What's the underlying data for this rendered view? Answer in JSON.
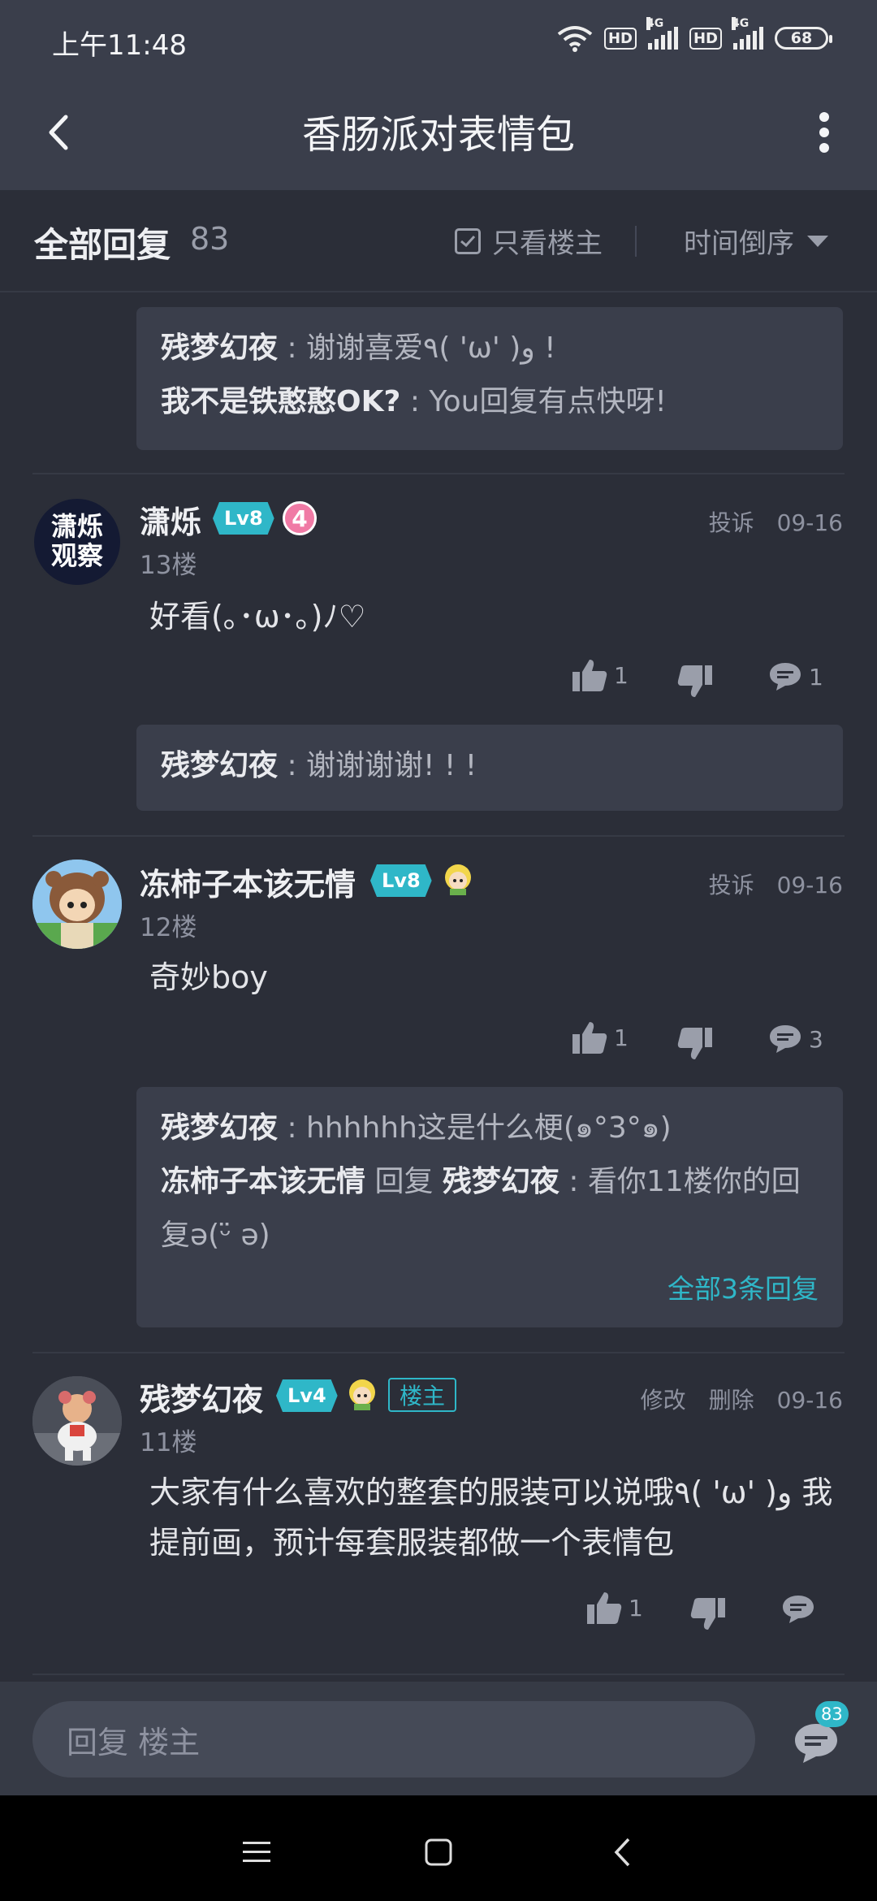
{
  "status": {
    "time": "上午11:48",
    "hd1": "HD",
    "net1": "4G",
    "hd2": "HD",
    "net2": "4G",
    "battery": "68"
  },
  "header": {
    "title": "香肠派对表情包"
  },
  "reply_bar": {
    "label": "全部回复",
    "count": "83",
    "only_op": "只看楼主",
    "sort": "时间倒序"
  },
  "sub_top": {
    "r1_user": "残梦幻夜",
    "r1_text": " : 谢谢喜爱٩( 'ω' )و !",
    "r2_user": "我不是铁憨憨OK?",
    "r2_text": "  : You回复有点快呀!"
  },
  "post13": {
    "user": "潇烁",
    "level": "Lv8",
    "badge_num": "4",
    "floor": "13楼",
    "report": "投诉",
    "date": "09-16",
    "content": "好看(｡･ω･｡)ﾉ♡",
    "likes": "1",
    "comments": "1",
    "reply_user": "残梦幻夜",
    "reply_text": " : 谢谢谢谢! ! !",
    "avatar_text_1": "潇烁",
    "avatar_text_2": "观察"
  },
  "post12": {
    "user": "冻柿子本该无情",
    "level": "Lv8",
    "floor": "12楼",
    "report": "投诉",
    "date": "09-16",
    "content": "奇妙boy",
    "likes": "1",
    "comments": "3",
    "r1_user": "残梦幻夜",
    "r1_text": " : hhhhhh这是什么梗(๑°3°๑)",
    "r2_user": "冻柿子本该无情",
    "r2_mid": " 回复 ",
    "r2_user2": "残梦幻夜",
    "r2_text": " : 看你11楼你的回复ә(ᵕ̈ ә)",
    "more": "全部3条回复"
  },
  "post11": {
    "user": "残梦幻夜",
    "level": "Lv4",
    "op_badge": "楼主",
    "floor": "11楼",
    "edit": "修改",
    "delete": "删除",
    "date": "09-16",
    "content": "大家有什么喜欢的整套的服装可以说哦٩( 'ω' )و 我提前画，预计每套服装都做一个表情包",
    "likes": "1"
  },
  "bottom": {
    "placeholder": "回复  楼主",
    "comment_count": "83"
  },
  "colors": {
    "accent": "#2fb7c8",
    "bg": "#2b2e38",
    "card": "#3a3e4b"
  }
}
